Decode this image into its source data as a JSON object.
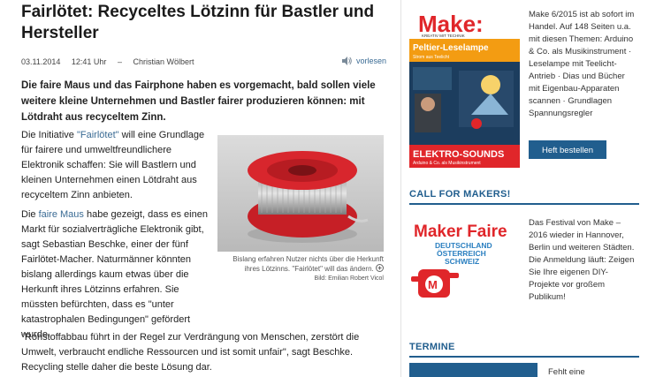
{
  "article": {
    "title": "Fairlötet: Recyceltes Lötzinn für Bastler und Hersteller",
    "date": "03.11.2014",
    "time": "12:41 Uhr",
    "separator": "–",
    "author": "Christian Wölbert",
    "read_aloud": "vorlesen",
    "lead": "Die faire Maus und das Fairphone haben es vorgemacht, bald sollen viele weitere kleine Unternehmen und Bastler fairer produzieren können: mit Lötdraht aus recyceltem Zinn.",
    "p1_before": "Die Initiative ",
    "p1_link": "\"Fairlötet\"",
    "p1_after": " will eine Grundlage für fairere und umweltfreundlichere Elektronik schaffen: Sie will Bastlern und kleinen Unternehmen einen Lötdraht aus recyceltem Zinn anbieten.",
    "p2_before": "Die ",
    "p2_link": "faire Maus",
    "p2_after": " habe gezeigt, dass es einen Markt für sozialverträgliche Elektronik gibt, sagt Sebastian Beschke, einer der fünf Fairlötet-Macher. Naturmänner könnten bislang allerdings kaum etwas über die Herkunft ihres Lötzinns erfahren. Sie müssten befürchten, dass es \"unter katastrophalen Bedingungen\" gefördert wurde.",
    "p3": "\"Rohstoffabbau führt in der Regel zur Verdrängung von Menschen, zerstört die Umwelt, verbraucht endliche Ressourcen und ist somit unfair\", sagt Beschke. Recycling stelle daher die beste Lösung dar.",
    "figure": {
      "caption": "Bislang erfahren Nutzer nichts über die Herkunft ihres Lötzinns. \"Fairlötet\" will das ändern.",
      "credit": "Bild: Emilian Robert Vicol"
    }
  },
  "sidebar": {
    "magazine": {
      "logo": "Make:",
      "tagline": "KREATIV MIT TECHNIK",
      "headline1": "Peltier-Leselampe",
      "sub1": "Strom aus Teelicht",
      "headline2": "ELEKTRO-SOUNDS",
      "sub2": "Arduino & Co. als Musikinstrument"
    },
    "promo_text": "Make 6/2015 ist ab sofort im Handel. Auf 148 Seiten u.a. mit diesen Themen: Arduino & Co. als Musikinstrument · Leselampe mit Teelicht-Antrieb · Dias und Bücher mit Eigenbau-Apparaten scannen · Grundlagen Spannungsregler",
    "order_button": "Heft bestellen",
    "call_title": "CALL FOR MAKERS!",
    "maker_faire": {
      "title": "Maker Faire",
      "line1": "DEUTSCHLAND",
      "line2": "ÖSTERREICH",
      "line3": "SCHWEIZ"
    },
    "call_text": "Das Festival von Make – 2016 wieder in Hannover, Berlin und weiteren Städten. Die Anmeldung läuft: Zeigen Sie Ihre eigenen DIY-Projekte vor großem Publikum!",
    "termine_title": "TERMINE",
    "termine_item": "Fehlt eine"
  },
  "colors": {
    "brand_blue": "#215e8e",
    "link_blue": "#3a6b94",
    "make_red": "#e0262a"
  }
}
